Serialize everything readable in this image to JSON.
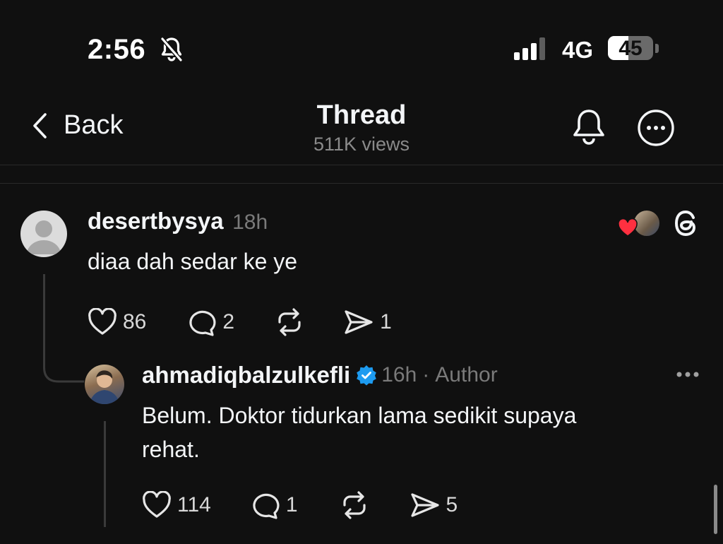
{
  "status_bar": {
    "time": "2:56",
    "network": "4G",
    "battery": "45",
    "battery_level": 0.45
  },
  "header": {
    "back_label": "Back",
    "title": "Thread",
    "views": "511K views"
  },
  "comment": {
    "username": "desertbysya",
    "time": "18h",
    "text": "diaa dah sedar ke ye",
    "likes": "86",
    "replies": "2",
    "shares": "1"
  },
  "reply": {
    "username": "ahmadiqbalzulkefli",
    "time": "16h",
    "separator": "·",
    "role": "Author",
    "text_line1": "Belum. Doktor tidurkan lama sedikit supaya",
    "text_line2": "rehat.",
    "likes": "114",
    "replies": "1",
    "shares": "5"
  },
  "colors": {
    "background": "#101010",
    "verified": "#1d9bf0",
    "heart": "#ff3040"
  },
  "icons": [
    "bell-muted-icon",
    "signal-icon",
    "chevron-left-icon",
    "bell-icon",
    "more-circle-icon",
    "threads-logo-icon",
    "heart-icon",
    "comment-icon",
    "repost-icon",
    "share-icon",
    "verified-badge-icon",
    "more-dots-icon"
  ]
}
